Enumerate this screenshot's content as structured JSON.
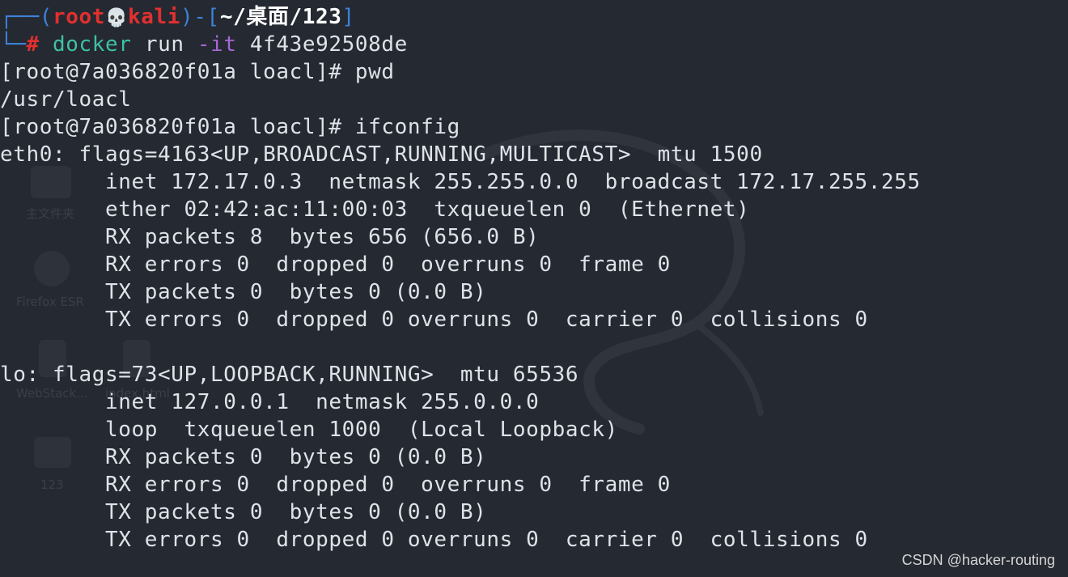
{
  "prompt": {
    "open_frame": "┌──(",
    "user": "root",
    "skull": "💀",
    "host": "kali",
    "close_frame": ")-[",
    "dir": "~/桌面/123",
    "close_bracket": "]",
    "second_frame": "└─",
    "hash": "#",
    "command": "docker",
    "args_before_flag": " run ",
    "flag": "-it",
    "args_after_flag": " 4f43e92508de"
  },
  "lines": [
    "[root@7a036820f01a loacl]# pwd",
    "/usr/loacl",
    "[root@7a036820f01a loacl]# ifconfig",
    "eth0: flags=4163<UP,BROADCAST,RUNNING,MULTICAST>  mtu 1500",
    "        inet 172.17.0.3  netmask 255.255.0.0  broadcast 172.17.255.255",
    "        ether 02:42:ac:11:00:03  txqueuelen 0  (Ethernet)",
    "        RX packets 8  bytes 656 (656.0 B)",
    "        RX errors 0  dropped 0  overruns 0  frame 0",
    "        TX packets 0  bytes 0 (0.0 B)",
    "        TX errors 0  dropped 0 overruns 0  carrier 0  collisions 0",
    "",
    "lo: flags=73<UP,LOOPBACK,RUNNING>  mtu 65536",
    "        inet 127.0.0.1  netmask 255.0.0.0",
    "        loop  txqueuelen 1000  (Local Loopback)",
    "        RX packets 0  bytes 0 (0.0 B)",
    "        RX errors 0  dropped 0  overruns 0  frame 0",
    "        TX packets 0  bytes 0 (0.0 B)",
    "        TX errors 0  dropped 0 overruns 0  carrier 0  collisions 0"
  ],
  "desktop_ghosts": {
    "home_folder": "主文件夹",
    "firefox": "Firefox ESR",
    "webstack": "WebStack...",
    "index_html": "index.html",
    "folder_123": "123"
  },
  "watermark": "CSDN @hacker-routing",
  "colors": {
    "background": "#252931",
    "text": "#dfe3e8",
    "prompt_frame": "#3d82d8",
    "prompt_user": "#e0302f",
    "command": "#3ec1a4",
    "flag": "#a568d6"
  }
}
